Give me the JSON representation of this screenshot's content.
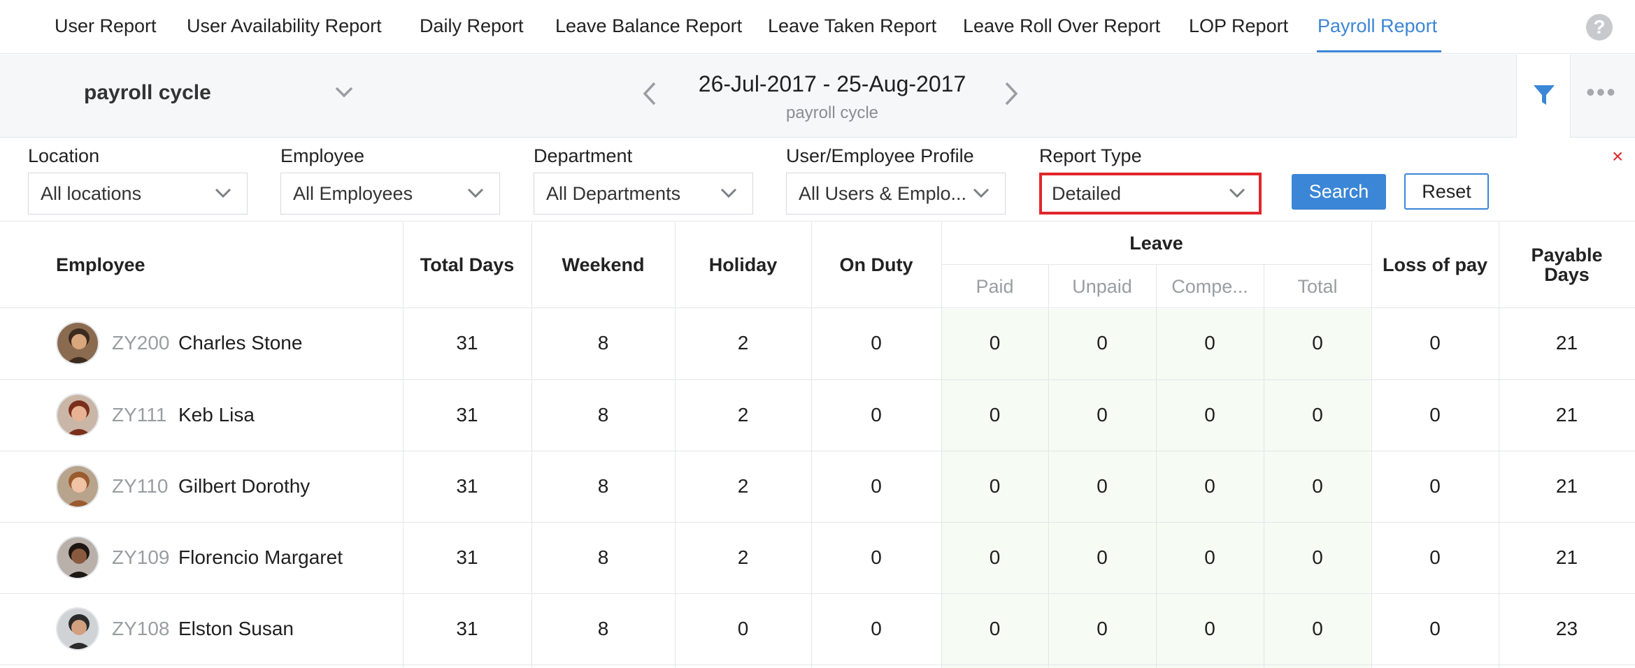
{
  "nav": {
    "tabs": [
      {
        "label": "User Report"
      },
      {
        "label": "User Availability Report"
      },
      {
        "label": "Daily Report"
      },
      {
        "label": "Leave Balance Report"
      },
      {
        "label": "Leave Taken Report"
      },
      {
        "label": "Leave Roll Over Report"
      },
      {
        "label": "LOP Report"
      },
      {
        "label": "Payroll Report"
      }
    ],
    "active_tab": "Payroll Report",
    "help_glyph": "?"
  },
  "cycle": {
    "selector_label": "payroll cycle",
    "date_range": "26-Jul-2017 - 25-Aug-2017",
    "date_subtitle": "payroll cycle"
  },
  "filters": {
    "location": {
      "label": "Location",
      "value": "All locations"
    },
    "employee": {
      "label": "Employee",
      "value": "All Employees"
    },
    "department": {
      "label": "Department",
      "value": "All Departments"
    },
    "profile": {
      "label": "User/Employee Profile",
      "value": "All Users & Emplo..."
    },
    "report_type": {
      "label": "Report Type",
      "value": "Detailed"
    },
    "search_label": "Search",
    "reset_label": "Reset",
    "close_glyph": "×"
  },
  "table": {
    "headers": {
      "employee": "Employee",
      "total_days": "Total Days",
      "weekend": "Weekend",
      "holiday": "Holiday",
      "on_duty": "On Duty",
      "leave": "Leave",
      "paid": "Paid",
      "unpaid": "Unpaid",
      "compe": "Compe...",
      "total": "Total",
      "loss_of_pay": "Loss of pay",
      "payable_days_1": "Payable",
      "payable_days_2": "Days"
    },
    "rows": [
      {
        "id": "ZY200",
        "name": "Charles Stone",
        "total_days": "31",
        "weekend": "8",
        "holiday": "2",
        "on_duty": "0",
        "paid": "0",
        "unpaid": "0",
        "compe": "0",
        "total": "0",
        "lop": "0",
        "payable": "21"
      },
      {
        "id": "ZY111",
        "name": "Keb Lisa",
        "total_days": "31",
        "weekend": "8",
        "holiday": "2",
        "on_duty": "0",
        "paid": "0",
        "unpaid": "0",
        "compe": "0",
        "total": "0",
        "lop": "0",
        "payable": "21"
      },
      {
        "id": "ZY110",
        "name": "Gilbert Dorothy",
        "total_days": "31",
        "weekend": "8",
        "holiday": "2",
        "on_duty": "0",
        "paid": "0",
        "unpaid": "0",
        "compe": "0",
        "total": "0",
        "lop": "0",
        "payable": "21"
      },
      {
        "id": "ZY109",
        "name": "Florencio Margaret",
        "total_days": "31",
        "weekend": "8",
        "holiday": "2",
        "on_duty": "0",
        "paid": "0",
        "unpaid": "0",
        "compe": "0",
        "total": "0",
        "lop": "0",
        "payable": "21"
      },
      {
        "id": "ZY108",
        "name": "Elston Susan",
        "total_days": "31",
        "weekend": "8",
        "holiday": "0",
        "on_duty": "0",
        "paid": "0",
        "unpaid": "0",
        "compe": "0",
        "total": "0",
        "lop": "0",
        "payable": "23"
      }
    ]
  },
  "colors": {
    "accent": "#3b86d6",
    "highlight_border": "#e0262b",
    "leave_bg": "#f6fbf3"
  }
}
